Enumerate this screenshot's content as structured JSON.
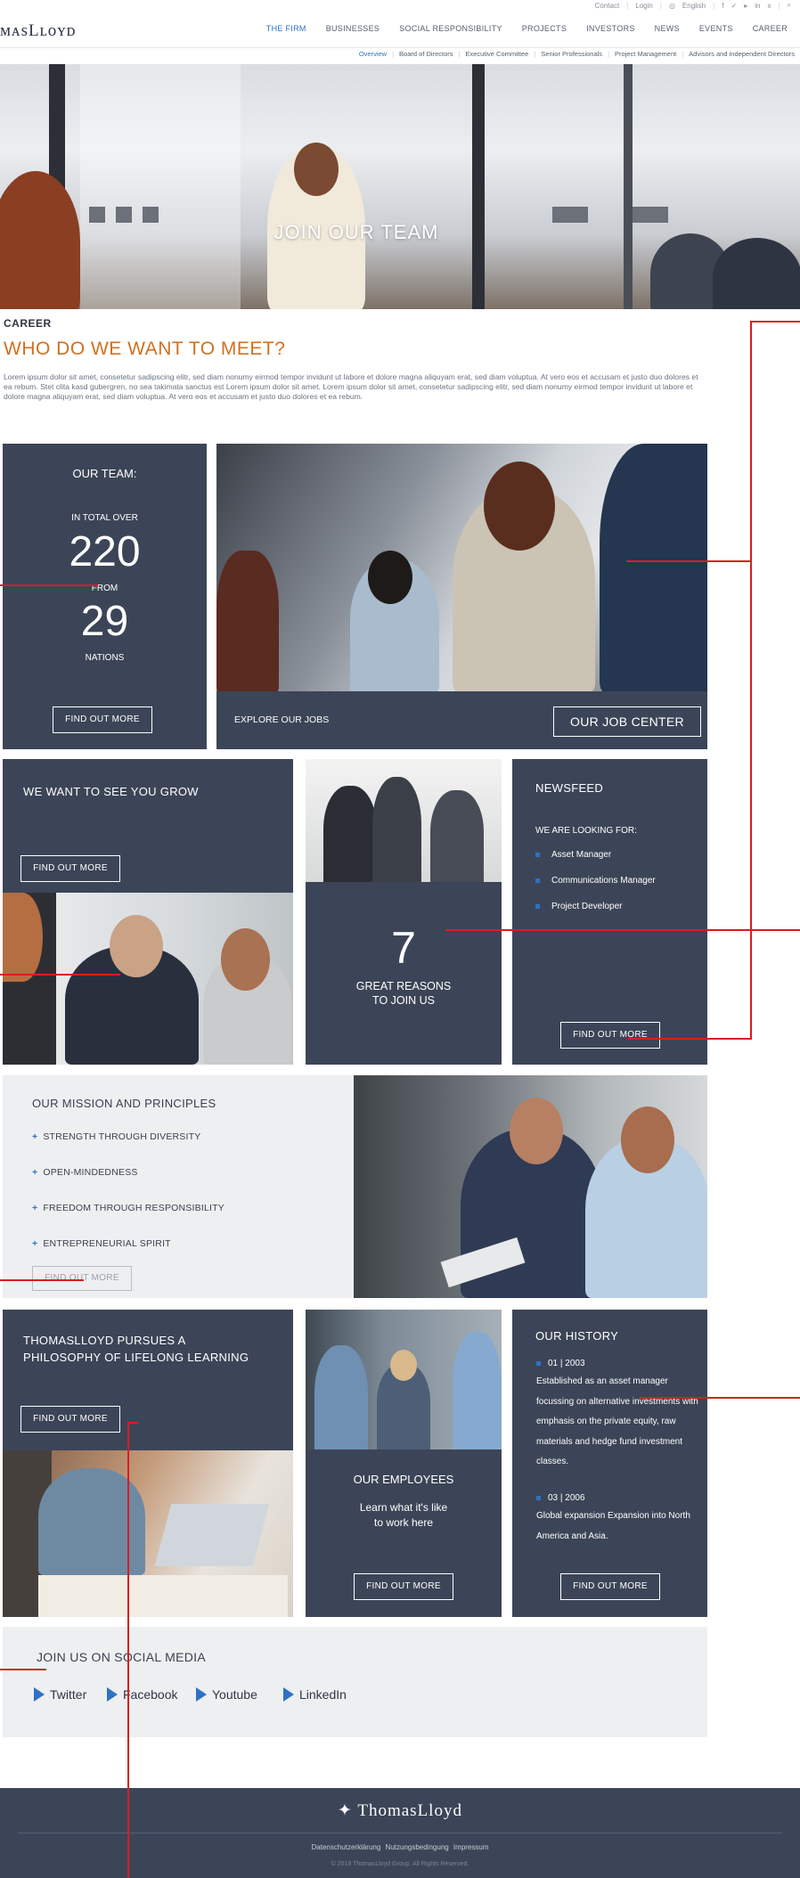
{
  "topbar": {
    "contact": "Contact",
    "login": "Login",
    "language": "English"
  },
  "brand": {
    "logo_text": "ᴍᴀsLʟᴏʏᴅ"
  },
  "nav": {
    "items": [
      "THE FIRM",
      "BUSINESSES",
      "SOCIAL RESPONSIBILITY",
      "PROJECTS",
      "INVESTORS",
      "NEWS",
      "EVENTS",
      "CAREER"
    ],
    "active_index": 0
  },
  "subnav": {
    "items": [
      "Overview",
      "Board of Directors",
      "Executive Committee",
      "Senior Professionals",
      "Project Management",
      "Advisors and independent Directors"
    ],
    "active_index": 0
  },
  "hero": {
    "title": "JOIN OUR TEAM"
  },
  "intro": {
    "label": "CAREER",
    "heading": "WHO DO WE WANT TO MEET?",
    "text": "Lorem ipsum dolor sit amet, consetetur sadipscing elitr, sed diam nonumy eirmod tempor invidunt ut labore et dolore magna aliquyam erat, sed diam voluptua. At vero eos et accusam et justo duo dolores et ea rebum. Stet clita kasd gubergren, no sea takimata sanctus est Lorem ipsum dolor sit amet. Lorem ipsum dolor sit amet, consetetur sadipscing elitr, sed diam nonumy eirmod tempor invidunt ut labore et dolore magna aliquyam erat, sed diam voluptua. At vero eos et accusam et justo duo dolores et ea rebum."
  },
  "team": {
    "title": "OUR TEAM:",
    "total_label": "IN TOTAL OVER",
    "total_count": "220",
    "from_label": "FROM",
    "nations_count": "29",
    "nations_label": "NATIONS",
    "button": "FIND OUT MORE"
  },
  "jobs": {
    "label": "EXPLORE OUR JOBS",
    "button": "OUR JOB CENTER"
  },
  "grow": {
    "title": "WE WANT TO SEE YOU GROW",
    "button": "FIND OUT MORE"
  },
  "reasons": {
    "count": "7",
    "line1": "GREAT REASONS",
    "line2": "TO JOIN US"
  },
  "newsfeed": {
    "title": "NEWSFEED",
    "subtitle": "WE ARE LOOKING FOR:",
    "items": [
      "Asset Manager",
      "Communications Manager",
      "Project Developer"
    ],
    "button": "FIND OUT MORE"
  },
  "mission": {
    "title": "OUR MISSION AND PRINCIPLES",
    "items": [
      "STRENGTH THROUGH DIVERSITY",
      "OPEN-MINDEDNESS",
      "FREEDOM THROUGH RESPONSIBILITY",
      "ENTREPRENEURIAL SPIRIT"
    ],
    "button": "FIND OUT MORE"
  },
  "learning": {
    "line1": "THOMASLLOYD PURSUES A",
    "line2": "PHILOSOPHY OF LIFELONG LEARNING",
    "button": "FIND OUT MORE"
  },
  "employees": {
    "title": "OUR EMPLOYEES",
    "line1": "Learn what it's like",
    "line2": "to work here",
    "button": "FIND OUT MORE"
  },
  "history": {
    "title": "OUR HISTORY",
    "entries": [
      {
        "date": "01 | 2003",
        "text": "Established as an asset manager focussing on alternative investments with emphasis on the private equity, raw materials and hedge fund investment classes."
      },
      {
        "date": "03 | 2006",
        "text": "Global expansion Expansion into North America and Asia."
      }
    ],
    "button": "FIND OUT MORE"
  },
  "social": {
    "title": "JOIN US ON SOCIAL MEDIA",
    "items": [
      "Twitter",
      "Facebook",
      "Youtube",
      "LinkedIn"
    ]
  },
  "footer": {
    "logo_text": "ThomasLloyd",
    "links": "Datenschutzerklärung  Nutzungsbedingung  Impressum",
    "copyright": "© 2018 ThomasLloyd Group. All Rights Reserved."
  },
  "colors": {
    "tile": "#3c4557",
    "accent_orange": "#d1701f",
    "accent_blue": "#2e72c4",
    "annotation_red": "#d81e1e"
  }
}
